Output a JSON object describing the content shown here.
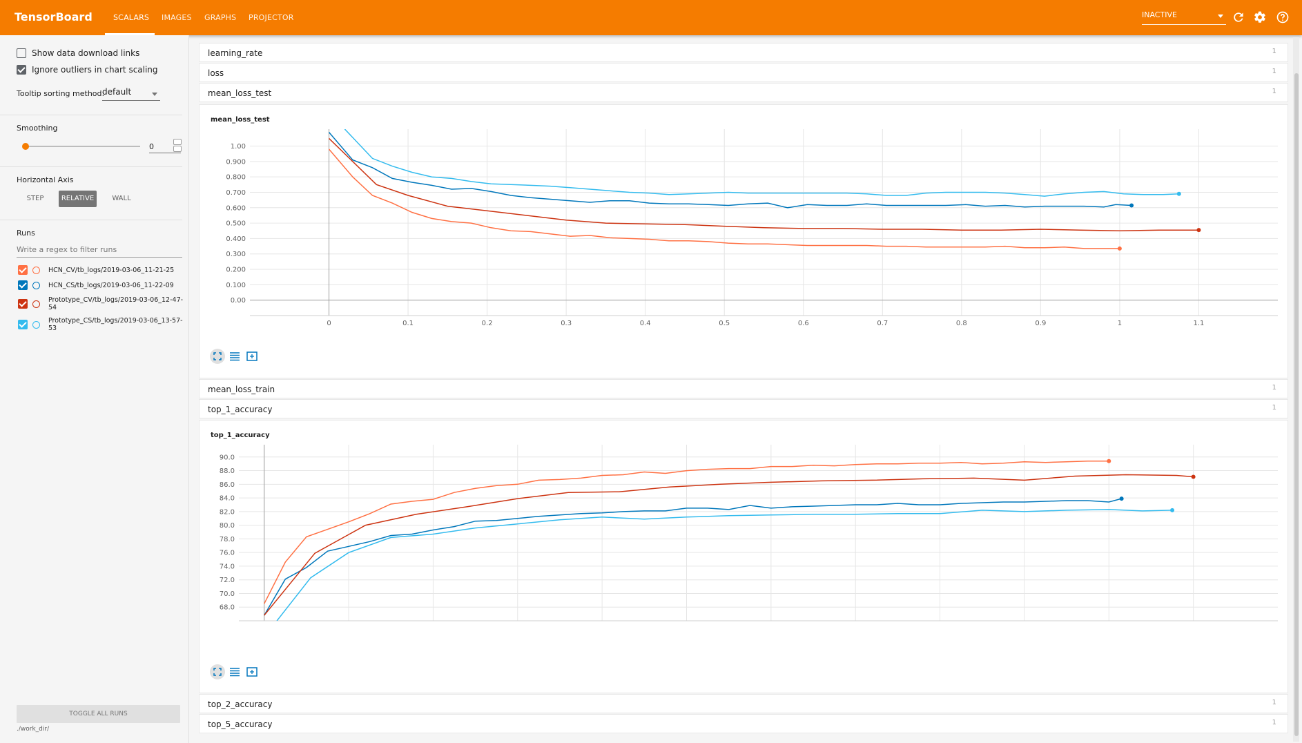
{
  "header": {
    "brand": "TensorBoard",
    "tabs": [
      {
        "label": "SCALARS",
        "active": true
      },
      {
        "label": "IMAGES",
        "active": false
      },
      {
        "label": "GRAPHS",
        "active": false
      },
      {
        "label": "PROJECTOR",
        "active": false
      }
    ],
    "status_select": "INACTIVE",
    "accent_color": "#f57c00"
  },
  "sidebar": {
    "show_download_links": {
      "label": "Show data download links",
      "checked": false
    },
    "ignore_outliers": {
      "label": "Ignore outliers in chart scaling",
      "checked": true
    },
    "tooltip_sorting": {
      "label": "Tooltip sorting method:",
      "value": "default"
    },
    "smoothing": {
      "label": "Smoothing",
      "value": "0"
    },
    "horizontal_axis": {
      "label": "Horizontal Axis",
      "options": [
        "STEP",
        "RELATIVE",
        "WALL"
      ],
      "selected": "RELATIVE"
    },
    "runs": {
      "label": "Runs",
      "filter_placeholder": "Write a regex to filter runs",
      "items": [
        {
          "name": "HCN_CV/tb_logs/2019-03-06_11-21-25",
          "color": "#ff7043",
          "checked": true
        },
        {
          "name": "HCN_CS/tb_logs/2019-03-06_11-22-09",
          "color": "#0077bb",
          "checked": true
        },
        {
          "name_line1": "Prototype_CV/tb_logs/2019-03-06_12-47-",
          "name_line2": "54",
          "color": "#cc3311",
          "checked": true
        },
        {
          "name_line1": "Prototype_CS/tb_logs/2019-03-06_13-57-",
          "name_line2": "53",
          "color": "#33bbee",
          "checked": true
        }
      ]
    },
    "toggle_all": "TOGGLE ALL RUNS",
    "logdir": "./work_dir/"
  },
  "main": {
    "categories": [
      {
        "name": "learning_rate",
        "count": "1"
      },
      {
        "name": "loss",
        "count": "1"
      },
      {
        "name": "mean_loss_test",
        "count": "1"
      },
      {
        "name": "mean_loss_train",
        "count": "1"
      },
      {
        "name": "top_1_accuracy",
        "count": "1"
      },
      {
        "name": "top_2_accuracy",
        "count": "1"
      },
      {
        "name": "top_5_accuracy",
        "count": "1"
      }
    ]
  },
  "chart_data": [
    {
      "type": "line",
      "title": "mean_loss_test",
      "xlim": [
        -0.1,
        1.2
      ],
      "ylim": [
        -0.1,
        1.11
      ],
      "xticks": [
        "0",
        "0.1",
        "0.2",
        "0.3",
        "0.4",
        "0.5",
        "0.6",
        "0.7",
        "0.8",
        "0.9",
        "1",
        "1.1"
      ],
      "yticks": [
        "0.00",
        "0.100",
        "0.200",
        "0.300",
        "0.400",
        "0.500",
        "0.600",
        "0.700",
        "0.800",
        "0.900",
        "1.00"
      ],
      "series": [
        {
          "color": "#ff7043",
          "x": [
            0,
            0.03,
            0.055,
            0.08,
            0.105,
            0.13,
            0.155,
            0.18,
            0.205,
            0.23,
            0.255,
            0.28,
            0.305,
            0.33,
            0.355,
            0.38,
            0.405,
            0.43,
            0.455,
            0.48,
            0.505,
            0.53,
            0.555,
            0.58,
            0.605,
            0.63,
            0.655,
            0.68,
            0.705,
            0.73,
            0.755,
            0.78,
            0.805,
            0.83,
            0.855,
            0.88,
            0.905,
            0.93,
            0.955,
            0.98,
            1.0
          ],
          "y": [
            0.98,
            0.8,
            0.68,
            0.63,
            0.57,
            0.53,
            0.51,
            0.5,
            0.47,
            0.45,
            0.445,
            0.43,
            0.415,
            0.42,
            0.405,
            0.4,
            0.395,
            0.385,
            0.385,
            0.38,
            0.37,
            0.365,
            0.365,
            0.36,
            0.355,
            0.355,
            0.355,
            0.355,
            0.35,
            0.35,
            0.345,
            0.345,
            0.345,
            0.345,
            0.35,
            0.34,
            0.34,
            0.345,
            0.335,
            0.335,
            0.335
          ]
        },
        {
          "color": "#0077bb",
          "x": [
            0,
            0.03,
            0.055,
            0.08,
            0.105,
            0.13,
            0.155,
            0.18,
            0.205,
            0.23,
            0.255,
            0.28,
            0.305,
            0.33,
            0.355,
            0.38,
            0.405,
            0.43,
            0.455,
            0.48,
            0.505,
            0.53,
            0.555,
            0.58,
            0.605,
            0.63,
            0.655,
            0.68,
            0.705,
            0.73,
            0.755,
            0.78,
            0.805,
            0.83,
            0.855,
            0.88,
            0.905,
            0.93,
            0.955,
            0.98,
            0.995,
            1.015
          ],
          "y": [
            1.09,
            0.91,
            0.86,
            0.79,
            0.765,
            0.745,
            0.72,
            0.725,
            0.705,
            0.68,
            0.665,
            0.655,
            0.645,
            0.635,
            0.645,
            0.645,
            0.63,
            0.625,
            0.625,
            0.62,
            0.615,
            0.625,
            0.63,
            0.6,
            0.62,
            0.615,
            0.615,
            0.625,
            0.615,
            0.615,
            0.615,
            0.615,
            0.62,
            0.61,
            0.615,
            0.605,
            0.61,
            0.61,
            0.61,
            0.605,
            0.62,
            0.615
          ]
        },
        {
          "color": "#cc3311",
          "x": [
            0,
            0.06,
            0.1,
            0.15,
            0.2,
            0.25,
            0.3,
            0.35,
            0.4,
            0.45,
            0.5,
            0.55,
            0.6,
            0.65,
            0.7,
            0.75,
            0.8,
            0.85,
            0.9,
            0.95,
            1.0,
            1.05,
            1.1
          ],
          "y": [
            1.05,
            0.75,
            0.68,
            0.61,
            0.58,
            0.55,
            0.52,
            0.5,
            0.495,
            0.49,
            0.48,
            0.47,
            0.465,
            0.465,
            0.46,
            0.46,
            0.455,
            0.455,
            0.46,
            0.455,
            0.45,
            0.455,
            0.455
          ]
        },
        {
          "color": "#33bbee",
          "x": [
            0.02,
            0.055,
            0.08,
            0.105,
            0.13,
            0.155,
            0.18,
            0.205,
            0.23,
            0.255,
            0.28,
            0.305,
            0.33,
            0.355,
            0.38,
            0.405,
            0.43,
            0.455,
            0.48,
            0.505,
            0.53,
            0.555,
            0.58,
            0.605,
            0.63,
            0.655,
            0.68,
            0.705,
            0.73,
            0.755,
            0.78,
            0.805,
            0.83,
            0.855,
            0.88,
            0.905,
            0.93,
            0.955,
            0.98,
            1.005,
            1.03,
            1.055,
            1.075
          ],
          "y": [
            1.11,
            0.92,
            0.87,
            0.83,
            0.8,
            0.79,
            0.77,
            0.755,
            0.75,
            0.745,
            0.74,
            0.73,
            0.72,
            0.71,
            0.7,
            0.695,
            0.685,
            0.69,
            0.695,
            0.7,
            0.695,
            0.695,
            0.695,
            0.695,
            0.695,
            0.695,
            0.69,
            0.68,
            0.68,
            0.695,
            0.7,
            0.7,
            0.7,
            0.695,
            0.685,
            0.675,
            0.69,
            0.7,
            0.705,
            0.69,
            0.685,
            0.685,
            0.69
          ]
        }
      ]
    },
    {
      "type": "line",
      "title": "top_1_accuracy",
      "xlim": [
        -0.03,
        1.2
      ],
      "ylim": [
        66.0,
        91.8
      ],
      "xticks": [],
      "yticks": [
        "68.0",
        "70.0",
        "72.0",
        "74.0",
        "76.0",
        "78.0",
        "80.0",
        "82.0",
        "84.0",
        "86.0",
        "88.0",
        "90.0"
      ],
      "series": [
        {
          "color": "#ff7043",
          "x": [
            0,
            0.025,
            0.05,
            0.075,
            0.1,
            0.125,
            0.15,
            0.175,
            0.2,
            0.225,
            0.25,
            0.275,
            0.3,
            0.325,
            0.35,
            0.375,
            0.4,
            0.425,
            0.45,
            0.475,
            0.5,
            0.525,
            0.55,
            0.575,
            0.6,
            0.625,
            0.65,
            0.675,
            0.7,
            0.725,
            0.75,
            0.775,
            0.8,
            0.825,
            0.85,
            0.875,
            0.9,
            0.925,
            0.95,
            0.975,
            1.0
          ],
          "y": [
            68.5,
            74.6,
            78.3,
            79.4,
            80.5,
            81.7,
            83.1,
            83.5,
            83.8,
            84.8,
            85.4,
            85.8,
            86.0,
            86.6,
            86.7,
            86.9,
            87.3,
            87.4,
            87.8,
            87.6,
            88.0,
            88.2,
            88.3,
            88.3,
            88.6,
            88.6,
            88.8,
            88.7,
            88.9,
            89.0,
            89.0,
            89.1,
            89.1,
            89.2,
            89.0,
            89.1,
            89.3,
            89.2,
            89.3,
            89.4,
            89.4
          ]
        },
        {
          "color": "#0077bb",
          "x": [
            0,
            0.025,
            0.05,
            0.075,
            0.1,
            0.125,
            0.15,
            0.175,
            0.2,
            0.225,
            0.25,
            0.275,
            0.3,
            0.325,
            0.35,
            0.375,
            0.4,
            0.425,
            0.45,
            0.475,
            0.5,
            0.525,
            0.55,
            0.575,
            0.6,
            0.625,
            0.65,
            0.675,
            0.7,
            0.725,
            0.75,
            0.775,
            0.8,
            0.825,
            0.85,
            0.875,
            0.9,
            0.925,
            0.95,
            0.975,
            1.0,
            1.015
          ],
          "y": [
            66.8,
            72.1,
            73.8,
            76.2,
            76.9,
            77.6,
            78.5,
            78.7,
            79.3,
            79.8,
            80.6,
            80.7,
            81.0,
            81.3,
            81.5,
            81.7,
            81.8,
            82.0,
            82.1,
            82.1,
            82.5,
            82.5,
            82.3,
            82.9,
            82.5,
            82.7,
            82.8,
            82.9,
            83.0,
            83.0,
            83.2,
            83.0,
            83.0,
            83.2,
            83.3,
            83.4,
            83.4,
            83.5,
            83.6,
            83.6,
            83.4,
            83.9
          ]
        },
        {
          "color": "#cc3311",
          "x": [
            0,
            0.06,
            0.12,
            0.18,
            0.24,
            0.3,
            0.36,
            0.42,
            0.48,
            0.54,
            0.6,
            0.66,
            0.72,
            0.78,
            0.84,
            0.9,
            0.96,
            1.02,
            1.08,
            1.1
          ],
          "y": [
            66.8,
            75.9,
            80.0,
            81.6,
            82.7,
            83.9,
            84.8,
            84.9,
            85.6,
            86.0,
            86.3,
            86.5,
            86.6,
            86.8,
            86.9,
            86.6,
            87.2,
            87.4,
            87.3,
            87.1
          ]
        },
        {
          "color": "#33bbee",
          "x": [
            0.015,
            0.055,
            0.1,
            0.15,
            0.2,
            0.25,
            0.3,
            0.35,
            0.4,
            0.45,
            0.5,
            0.55,
            0.6,
            0.65,
            0.7,
            0.75,
            0.8,
            0.85,
            0.9,
            0.95,
            1.0,
            1.04,
            1.075
          ],
          "y": [
            66.0,
            72.3,
            76.0,
            78.2,
            78.7,
            79.6,
            80.2,
            80.8,
            81.2,
            80.9,
            81.2,
            81.4,
            81.5,
            81.6,
            81.6,
            81.7,
            81.7,
            82.2,
            82.0,
            82.2,
            82.3,
            82.1,
            82.2
          ]
        }
      ]
    }
  ]
}
